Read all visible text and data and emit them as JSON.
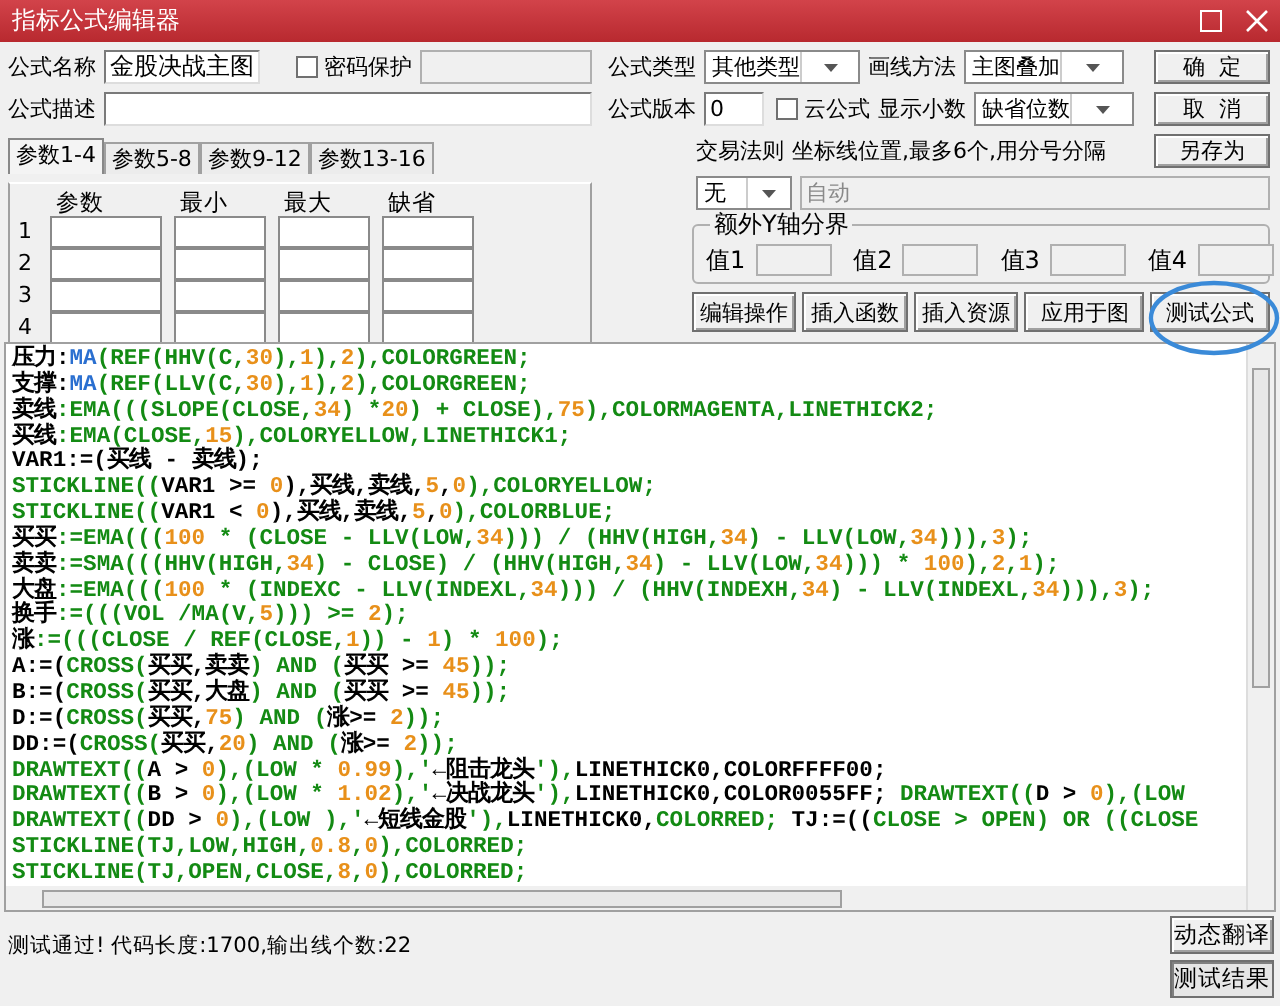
{
  "window": {
    "title": "指标公式编辑器"
  },
  "form": {
    "name_label": "公式名称",
    "name_value": "金股决战主图",
    "password": {
      "label": "密码保护",
      "checked": false
    },
    "type_label": "公式类型",
    "type_value": "其他类型",
    "draw_label": "画线方法",
    "draw_value": "主图叠加",
    "desc_label": "公式描述",
    "version_label": "公式版本",
    "version_value": "0",
    "cloud": {
      "label": "云公式",
      "checked": false
    },
    "decimals_label": "显示小数",
    "decimals_value": "缺省位数",
    "trade_rule_label": "交易法则",
    "trade_rule_value": "无",
    "axis_label": "坐标线位置,最多6个,用分号分隔",
    "axis_field": {
      "value": "自动",
      "disabled": true
    }
  },
  "param_tabs": [
    {
      "label": "参数1-4",
      "selected": true
    },
    {
      "label": "参数5-8",
      "selected": false
    },
    {
      "label": "参数9-12",
      "selected": false
    },
    {
      "label": "参数13-16",
      "selected": false
    }
  ],
  "param_table": {
    "columns": [
      "参数",
      "最小",
      "最大",
      "缺省"
    ],
    "rows": [
      "1",
      "2",
      "3",
      "4"
    ]
  },
  "y_axis_group": {
    "title": "额外Y轴分界",
    "fields": [
      "值1",
      "值2",
      "值3",
      "值4"
    ]
  },
  "side_buttons": [
    "确  定",
    "取  消",
    "另存为"
  ],
  "action_buttons": [
    "编辑操作",
    "插入函数",
    "插入资源",
    "应用于图",
    "测试公式"
  ],
  "code_lines": [
    [
      {
        "kind": "plain",
        "text": "压力:"
      },
      {
        "kind": "fn",
        "text": "MA"
      },
      {
        "kind": "kw",
        "text": "(REF(HHV(C,"
      },
      {
        "kind": "num",
        "text": "30"
      },
      {
        "kind": "kw",
        "text": "),"
      },
      {
        "kind": "num",
        "text": "1"
      },
      {
        "kind": "kw",
        "text": "),"
      },
      {
        "kind": "num",
        "text": "2"
      },
      {
        "kind": "kw",
        "text": "),COLORGREEN;"
      }
    ],
    [
      {
        "kind": "plain",
        "text": "支撑:"
      },
      {
        "kind": "fn",
        "text": "MA"
      },
      {
        "kind": "kw",
        "text": "(REF(LLV(C,"
      },
      {
        "kind": "num",
        "text": "30"
      },
      {
        "kind": "kw",
        "text": "),"
      },
      {
        "kind": "num",
        "text": "1"
      },
      {
        "kind": "kw",
        "text": "),"
      },
      {
        "kind": "num",
        "text": "2"
      },
      {
        "kind": "kw",
        "text": "),COLORGREEN;"
      }
    ],
    [
      {
        "kind": "plain",
        "text": "卖线"
      },
      {
        "kind": "kw",
        "text": ":EMA(((SLOPE(CLOSE,"
      },
      {
        "kind": "num",
        "text": "34"
      },
      {
        "kind": "kw",
        "text": ") *"
      },
      {
        "kind": "num",
        "text": "20"
      },
      {
        "kind": "kw",
        "text": ") + CLOSE),"
      },
      {
        "kind": "num",
        "text": "75"
      },
      {
        "kind": "kw",
        "text": "),COLORMAGENTA,LINETHICK2;"
      }
    ],
    [
      {
        "kind": "plain",
        "text": "买线"
      },
      {
        "kind": "kw",
        "text": ":EMA(CLOSE,"
      },
      {
        "kind": "num",
        "text": "15"
      },
      {
        "kind": "kw",
        "text": "),COLORYELLOW,LINETHICK1;"
      }
    ],
    [
      {
        "kind": "plain",
        "text": "VAR1:=(买线 - 卖线);"
      }
    ],
    [
      {
        "kind": "kw",
        "text": "STICKLINE(("
      },
      {
        "kind": "plain",
        "text": "VAR1 >= "
      },
      {
        "kind": "num",
        "text": "0"
      },
      {
        "kind": "plain",
        "text": "),买线,卖线,"
      },
      {
        "kind": "num",
        "text": "5"
      },
      {
        "kind": "plain",
        "text": ","
      },
      {
        "kind": "num",
        "text": "0"
      },
      {
        "kind": "kw",
        "text": "),COLORYELLOW;"
      }
    ],
    [
      {
        "kind": "kw",
        "text": "STICKLINE(("
      },
      {
        "kind": "plain",
        "text": "VAR1 < "
      },
      {
        "kind": "num",
        "text": "0"
      },
      {
        "kind": "plain",
        "text": "),买线,卖线,"
      },
      {
        "kind": "num",
        "text": "5"
      },
      {
        "kind": "plain",
        "text": ","
      },
      {
        "kind": "num",
        "text": "0"
      },
      {
        "kind": "kw",
        "text": "),COLORBLUE;"
      }
    ],
    [
      {
        "kind": "plain",
        "text": "买买"
      },
      {
        "kind": "kw",
        "text": ":=EMA((("
      },
      {
        "kind": "num",
        "text": "100"
      },
      {
        "kind": "kw",
        "text": " * (CLOSE - LLV(LOW,"
      },
      {
        "kind": "num",
        "text": "34"
      },
      {
        "kind": "kw",
        "text": "))) / (HHV(HIGH,"
      },
      {
        "kind": "num",
        "text": "34"
      },
      {
        "kind": "kw",
        "text": ") - LLV(LOW,"
      },
      {
        "kind": "num",
        "text": "34"
      },
      {
        "kind": "kw",
        "text": "))),"
      },
      {
        "kind": "num",
        "text": "3"
      },
      {
        "kind": "kw",
        "text": ");"
      }
    ],
    [
      {
        "kind": "plain",
        "text": "卖卖"
      },
      {
        "kind": "kw",
        "text": ":=SMA(((HHV(HIGH,"
      },
      {
        "kind": "num",
        "text": "34"
      },
      {
        "kind": "kw",
        "text": ") - CLOSE) / (HHV(HIGH,"
      },
      {
        "kind": "num",
        "text": "34"
      },
      {
        "kind": "kw",
        "text": ") - LLV(LOW,"
      },
      {
        "kind": "num",
        "text": "34"
      },
      {
        "kind": "kw",
        "text": "))) * "
      },
      {
        "kind": "num",
        "text": "100"
      },
      {
        "kind": "kw",
        "text": "),"
      },
      {
        "kind": "num",
        "text": "2"
      },
      {
        "kind": "kw",
        "text": ","
      },
      {
        "kind": "num",
        "text": "1"
      },
      {
        "kind": "kw",
        "text": ");"
      }
    ],
    [
      {
        "kind": "plain",
        "text": "大盘"
      },
      {
        "kind": "kw",
        "text": ":=EMA((("
      },
      {
        "kind": "num",
        "text": "100"
      },
      {
        "kind": "kw",
        "text": " * (INDEXC - LLV(INDEXL,"
      },
      {
        "kind": "num",
        "text": "34"
      },
      {
        "kind": "kw",
        "text": "))) / (HHV(INDEXH,"
      },
      {
        "kind": "num",
        "text": "34"
      },
      {
        "kind": "kw",
        "text": ") - LLV(INDEXL,"
      },
      {
        "kind": "num",
        "text": "34"
      },
      {
        "kind": "kw",
        "text": "))),"
      },
      {
        "kind": "num",
        "text": "3"
      },
      {
        "kind": "kw",
        "text": ");"
      }
    ],
    [
      {
        "kind": "plain",
        "text": "换手"
      },
      {
        "kind": "kw",
        "text": ":=(((VOL /MA(V,"
      },
      {
        "kind": "num",
        "text": "5"
      },
      {
        "kind": "kw",
        "text": "))) >= "
      },
      {
        "kind": "num",
        "text": "2"
      },
      {
        "kind": "kw",
        "text": ");"
      }
    ],
    [
      {
        "kind": "plain",
        "text": "涨"
      },
      {
        "kind": "kw",
        "text": ":=(((CLOSE / REF(CLOSE,"
      },
      {
        "kind": "num",
        "text": "1"
      },
      {
        "kind": "kw",
        "text": ")) - "
      },
      {
        "kind": "num",
        "text": "1"
      },
      {
        "kind": "kw",
        "text": ") * "
      },
      {
        "kind": "num",
        "text": "100"
      },
      {
        "kind": "kw",
        "text": ");"
      }
    ],
    [
      {
        "kind": "plain",
        "text": "A:=("
      },
      {
        "kind": "kw",
        "text": "CROSS("
      },
      {
        "kind": "plain",
        "text": "买买,卖卖"
      },
      {
        "kind": "kw",
        "text": ") AND ("
      },
      {
        "kind": "plain",
        "text": "买买 >= "
      },
      {
        "kind": "num",
        "text": "45"
      },
      {
        "kind": "kw",
        "text": "));"
      }
    ],
    [
      {
        "kind": "plain",
        "text": "B:=("
      },
      {
        "kind": "kw",
        "text": "CROSS("
      },
      {
        "kind": "plain",
        "text": "买买,大盘"
      },
      {
        "kind": "kw",
        "text": ") AND ("
      },
      {
        "kind": "plain",
        "text": "买买 >= "
      },
      {
        "kind": "num",
        "text": "45"
      },
      {
        "kind": "kw",
        "text": "));"
      }
    ],
    [
      {
        "kind": "plain",
        "text": "D:=("
      },
      {
        "kind": "kw",
        "text": "CROSS("
      },
      {
        "kind": "plain",
        "text": "买买,"
      },
      {
        "kind": "num",
        "text": "75"
      },
      {
        "kind": "kw",
        "text": ") AND ("
      },
      {
        "kind": "plain",
        "text": "涨>= "
      },
      {
        "kind": "num",
        "text": "2"
      },
      {
        "kind": "kw",
        "text": "));"
      }
    ],
    [
      {
        "kind": "plain",
        "text": "DD:=("
      },
      {
        "kind": "kw",
        "text": "CROSS("
      },
      {
        "kind": "plain",
        "text": "买买,"
      },
      {
        "kind": "num",
        "text": "20"
      },
      {
        "kind": "kw",
        "text": ") AND ("
      },
      {
        "kind": "plain",
        "text": "涨>= "
      },
      {
        "kind": "num",
        "text": "2"
      },
      {
        "kind": "kw",
        "text": "));"
      }
    ],
    [
      {
        "kind": "kw",
        "text": "DRAWTEXT(("
      },
      {
        "kind": "plain",
        "text": "A > "
      },
      {
        "kind": "num",
        "text": "0"
      },
      {
        "kind": "kw",
        "text": "),(LOW * "
      },
      {
        "kind": "num",
        "text": "0.99"
      },
      {
        "kind": "kw",
        "text": "),'"
      },
      {
        "kind": "plain",
        "text": "←阻击龙头"
      },
      {
        "kind": "kw",
        "text": "'),"
      },
      {
        "kind": "plain",
        "text": "LINETHICK0,COLORFFFF00;"
      }
    ],
    [
      {
        "kind": "kw",
        "text": "DRAWTEXT(("
      },
      {
        "kind": "plain",
        "text": "B > "
      },
      {
        "kind": "num",
        "text": "0"
      },
      {
        "kind": "kw",
        "text": "),(LOW * "
      },
      {
        "kind": "num",
        "text": "1.02"
      },
      {
        "kind": "kw",
        "text": "),'"
      },
      {
        "kind": "plain",
        "text": "←决战龙头"
      },
      {
        "kind": "kw",
        "text": "'),"
      },
      {
        "kind": "plain",
        "text": "LINETHICK0,COLOR0055FF; "
      },
      {
        "kind": "kw",
        "text": "DRAWTEXT(("
      },
      {
        "kind": "plain",
        "text": "D > "
      },
      {
        "kind": "num",
        "text": "0"
      },
      {
        "kind": "kw",
        "text": "),(LOW"
      }
    ],
    [
      {
        "kind": "kw",
        "text": "DRAWTEXT(("
      },
      {
        "kind": "plain",
        "text": "DD > "
      },
      {
        "kind": "num",
        "text": "0"
      },
      {
        "kind": "kw",
        "text": "),(LOW ),'"
      },
      {
        "kind": "plain",
        "text": "←短线金股"
      },
      {
        "kind": "kw",
        "text": "'),"
      },
      {
        "kind": "plain",
        "text": "LINETHICK0,"
      },
      {
        "kind": "kw",
        "text": "COLORRED;"
      },
      {
        "kind": "plain",
        "text": " TJ:=(("
      },
      {
        "kind": "kw",
        "text": "CLOSE > OPEN) OR ((CLOSE"
      }
    ],
    [
      {
        "kind": "kw",
        "text": "STICKLINE(TJ,LOW,HIGH,"
      },
      {
        "kind": "num",
        "text": "0.8"
      },
      {
        "kind": "kw",
        "text": ","
      },
      {
        "kind": "num",
        "text": "0"
      },
      {
        "kind": "kw",
        "text": "),COLORRED;"
      }
    ],
    [
      {
        "kind": "kw",
        "text": "STICKLINE(TJ,OPEN,CLOSE,"
      },
      {
        "kind": "num",
        "text": "8"
      },
      {
        "kind": "kw",
        "text": ","
      },
      {
        "kind": "num",
        "text": "0"
      },
      {
        "kind": "kw",
        "text": "),COLORRED;"
      }
    ]
  ],
  "status": "测试通过! 代码长度:1700,输出线个数:22",
  "result_buttons": [
    {
      "label": "动态翻译",
      "selected": false
    },
    {
      "label": "测试结果",
      "selected": true
    }
  ]
}
